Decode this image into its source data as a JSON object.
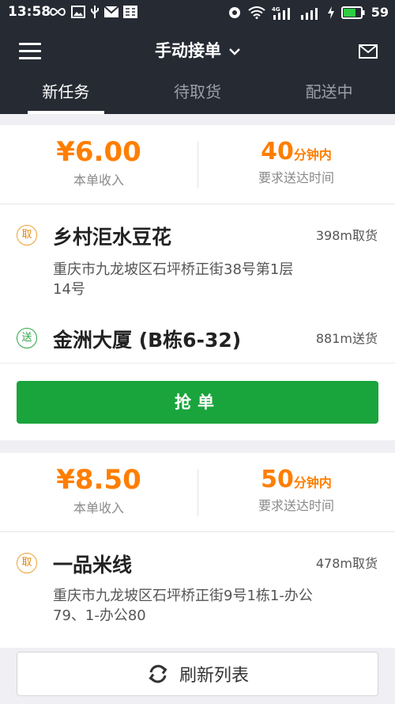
{
  "status_bar": {
    "time": "13:58",
    "battery": "59"
  },
  "header": {
    "title": "手动接单"
  },
  "tabs": [
    {
      "label": "新任务"
    },
    {
      "label": "待取货"
    },
    {
      "label": "配送中"
    }
  ],
  "orders": [
    {
      "price": "¥6.00",
      "price_label": "本单收入",
      "minutes": "40",
      "minutes_unit": "分钟内",
      "time_label": "要求送达时间",
      "pickup_badge": "取",
      "pickup_name": "乡村洰水豆花",
      "pickup_distance": "398m取货",
      "pickup_address": "重庆市九龙坡区石坪桥正街38号第1层14号",
      "delivery_badge": "送",
      "delivery_name": "金洲大厦 (B栋6-32)",
      "delivery_distance": "881m送货",
      "grab_label": "抢单"
    },
    {
      "price": "¥8.50",
      "price_label": "本单收入",
      "minutes": "50",
      "minutes_unit": "分钟内",
      "time_label": "要求送达时间",
      "pickup_badge": "取",
      "pickup_name": "一品米线",
      "pickup_distance": "478m取货",
      "pickup_address": "重庆市九龙坡区石坪桥正街9号1栋1-办公79、1-办公80"
    }
  ],
  "refresh_label": "刷新列表",
  "colors": {
    "accent_orange": "#ff7e00",
    "grab_green": "#1aa43c",
    "header_dark": "#262a33"
  },
  "icons": [
    "menu-icon",
    "chevron-down-icon",
    "mail-icon",
    "refresh-icon"
  ]
}
